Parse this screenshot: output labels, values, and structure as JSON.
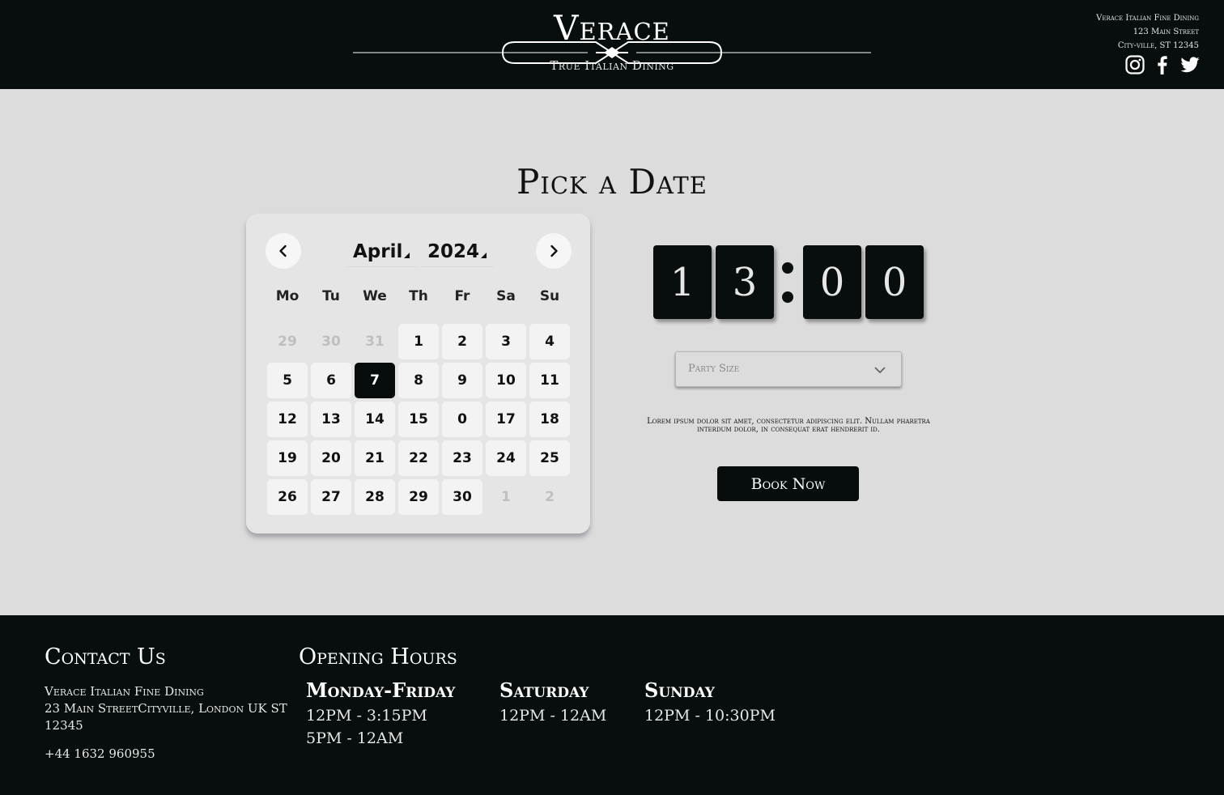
{
  "header": {
    "brand": "Verace",
    "tagline": "True Italian Dining",
    "address": [
      "Verace Italian Fine Dining",
      "123 Main Street",
      "City-ville, ST 12345"
    ],
    "social": [
      "instagram-icon",
      "facebook-icon",
      "twitter-icon"
    ]
  },
  "main": {
    "title": "Pick a Date",
    "calendar": {
      "month": "April",
      "year": "2024",
      "weekdays": [
        "Mo",
        "Tu",
        "We",
        "Th",
        "Fr",
        "Sa",
        "Su"
      ],
      "days": [
        "29",
        "30",
        "31",
        "1",
        "2",
        "3",
        "4",
        "5",
        "6",
        "7",
        "8",
        "9",
        "10",
        "11",
        "12",
        "13",
        "14",
        "15",
        "0",
        "17",
        "18",
        "19",
        "20",
        "21",
        "22",
        "23",
        "24",
        "25",
        "26",
        "27",
        "28",
        "29",
        "30",
        "1",
        "2"
      ],
      "muted": [
        0,
        1,
        2,
        33,
        34
      ],
      "selected_index": 9
    },
    "time": {
      "d1": "1",
      "d2": "3",
      "d3": "0",
      "d4": "0"
    },
    "party_size_placeholder": "Party Size",
    "lorem": "Lorem ipsum dolor sit amet, consectetur adipiscing elit. Nullam pharetra interdum dolor, in consequat erat hendrerit id.",
    "book_label": "Book Now"
  },
  "footer": {
    "contact_title": "Contact Us",
    "contact_name": "Verace Italian Fine Dining",
    "contact_address": "23 Main StreetCityville, London UK ST 12345",
    "phone": "+44 1632 960955",
    "hours_title": "Opening Hours",
    "hours": [
      {
        "day": "Monday-Friday",
        "times": [
          "12PM - 3:15PM",
          "5PM - 12AM"
        ]
      },
      {
        "day": "Saturday",
        "times": [
          "12PM - 12AM"
        ]
      },
      {
        "day": "Sunday",
        "times": [
          "12PM - 10:30PM"
        ]
      }
    ]
  },
  "colors": {
    "dark": "#080e0e",
    "background": "#dcdcdc",
    "calendar_bg": "#e5e5e5"
  }
}
